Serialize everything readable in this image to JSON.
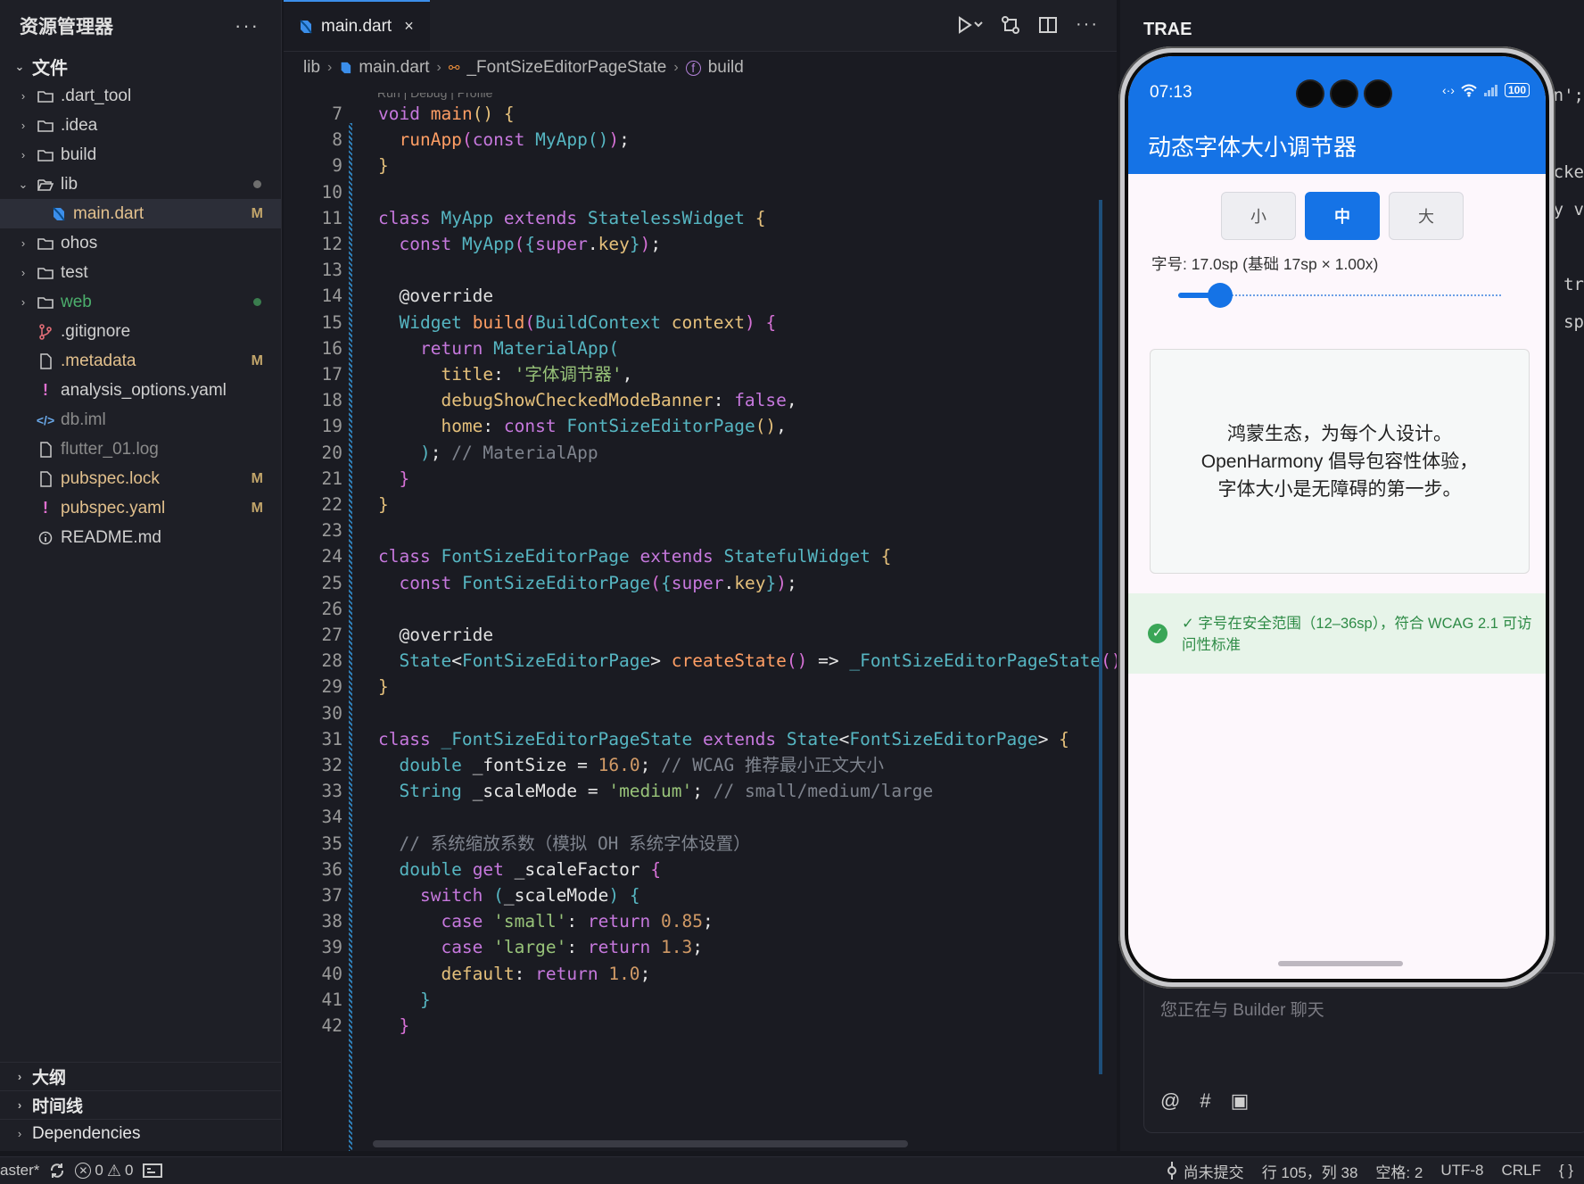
{
  "explorer": {
    "title": "资源管理器",
    "more": "···",
    "section_files": "文件",
    "items": [
      {
        "label": ".dart_tool",
        "type": "folder",
        "status": ""
      },
      {
        "label": ".idea",
        "type": "folder",
        "status": ""
      },
      {
        "label": "build",
        "type": "folder",
        "status": ""
      },
      {
        "label": "lib",
        "type": "folder-open",
        "status": ""
      },
      {
        "label": "main.dart",
        "type": "dart",
        "status": "M"
      },
      {
        "label": "ohos",
        "type": "folder",
        "status": ""
      },
      {
        "label": "test",
        "type": "folder",
        "status": ""
      },
      {
        "label": "web",
        "type": "folder",
        "status": ""
      },
      {
        "label": ".gitignore",
        "type": "git",
        "status": ""
      },
      {
        "label": ".metadata",
        "type": "file",
        "status": "M"
      },
      {
        "label": "analysis_options.yaml",
        "type": "yaml",
        "status": ""
      },
      {
        "label": "db.iml",
        "type": "code",
        "status": ""
      },
      {
        "label": "flutter_01.log",
        "type": "file",
        "status": ""
      },
      {
        "label": "pubspec.lock",
        "type": "file",
        "status": "M"
      },
      {
        "label": "pubspec.yaml",
        "type": "yaml",
        "status": "M"
      },
      {
        "label": "README.md",
        "type": "info",
        "status": ""
      }
    ],
    "bottom": [
      "大纲",
      "时间线",
      "Dependencies"
    ]
  },
  "editor": {
    "tab_label": "main.dart",
    "tab_close": "×",
    "breadcrumb": [
      "lib",
      "main.dart",
      "_FontSizeEditorPageState",
      "build"
    ],
    "codelens": "Run | Debug | Profile",
    "lines": [
      {
        "n": "7",
        "html": "<span class='kw'>void</span> <span class='fn'>main</span><span class='pn'>()</span> <span class='pn'>{</span>"
      },
      {
        "n": "8",
        "html": "  <span class='fn'>runApp</span><span class='pr'>(</span><span class='kw'>const</span> <span class='cls'>MyApp</span><span class='cls'>()</span><span class='pr'>)</span>;"
      },
      {
        "n": "9",
        "html": "<span class='pn'>}</span>"
      },
      {
        "n": "10",
        "html": ""
      },
      {
        "n": "11",
        "html": "<span class='kw'>class</span> <span class='cls'>MyApp</span> <span class='kw'>extends</span> <span class='cls'>StatelessWidget</span> <span class='pn'>{</span>"
      },
      {
        "n": "12",
        "html": "  <span class='kw'>const</span> <span class='cls'>MyApp</span><span class='pr'>(</span><span class='cls'>{</span><span class='kw'>super</span>.<span class='prop'>key</span><span class='cls'>}</span><span class='pr'>)</span>;"
      },
      {
        "n": "13",
        "html": ""
      },
      {
        "n": "14",
        "html": "  <span class='ann'>@override</span>"
      },
      {
        "n": "15",
        "html": "  <span class='cls'>Widget</span> <span class='fn'>build</span><span class='pr'>(</span><span class='cls'>BuildContext</span> <span class='prop'>context</span><span class='pr'>)</span> <span class='pr'>{</span>"
      },
      {
        "n": "16",
        "html": "    <span class='kw'>return</span> <span class='cls'>MaterialApp</span><span class='cls'>(</span>"
      },
      {
        "n": "17",
        "html": "      <span class='prop'>title</span>: <span class='str'>'字体调节器'</span>,"
      },
      {
        "n": "18",
        "html": "      <span class='prop'>debugShowCheckedModeBanner</span>: <span class='kw'>false</span>,"
      },
      {
        "n": "19",
        "html": "      <span class='prop'>home</span>: <span class='kw'>const</span> <span class='cls'>FontSizeEditorPage</span><span class='pn'>()</span>,"
      },
      {
        "n": "20",
        "html": "    <span class='cls'>)</span>; <span class='cm'>// MaterialApp</span>"
      },
      {
        "n": "21",
        "html": "  <span class='pr'>}</span>"
      },
      {
        "n": "22",
        "html": "<span class='pn'>}</span>"
      },
      {
        "n": "23",
        "html": ""
      },
      {
        "n": "24",
        "html": "<span class='kw'>class</span> <span class='cls'>FontSizeEditorPage</span> <span class='kw'>extends</span> <span class='cls'>StatefulWidget</span> <span class='pn'>{</span>"
      },
      {
        "n": "25",
        "html": "  <span class='kw'>const</span> <span class='cls'>FontSizeEditorPage</span><span class='pr'>(</span><span class='cls'>{</span><span class='kw'>super</span>.<span class='prop'>key</span><span class='cls'>}</span><span class='pr'>)</span>;"
      },
      {
        "n": "26",
        "html": ""
      },
      {
        "n": "27",
        "html": "  <span class='ann'>@override</span>"
      },
      {
        "n": "28",
        "html": "  <span class='cls'>State</span>&lt;<span class='cls'>FontSizeEditorPage</span>&gt; <span class='fn'>createState</span><span class='pr'>()</span> =&gt; <span class='cls'>_FontSizeEditorPageState</span><span class='pr'>()</span>"
      },
      {
        "n": "29",
        "html": "<span class='pn'>}</span>"
      },
      {
        "n": "30",
        "html": ""
      },
      {
        "n": "31",
        "html": "<span class='kw'>class</span> <span class='cls'>_FontSizeEditorPageState</span> <span class='kw'>extends</span> <span class='cls'>State</span>&lt;<span class='cls'>FontSizeEditorPage</span>&gt; <span class='pn'>{</span>"
      },
      {
        "n": "32",
        "html": "  <span class='cls'>double</span> <span class='id'>_fontSize</span> = <span class='num'>16.0</span>; <span class='cm'>// WCAG 推荐最小正文大小</span>"
      },
      {
        "n": "33",
        "html": "  <span class='cls'>String</span> <span class='id'>_scaleMode</span> = <span class='str'>'medium'</span>; <span class='cm'>// small/medium/large</span>"
      },
      {
        "n": "34",
        "html": ""
      },
      {
        "n": "35",
        "html": "  <span class='cm'>// 系统缩放系数（模拟 OH 系统字体设置）</span>"
      },
      {
        "n": "36",
        "html": "  <span class='cls'>double</span> <span class='kw'>get</span> <span class='id'>_scaleFactor</span> <span class='pr'>{</span>"
      },
      {
        "n": "37",
        "html": "    <span class='kw'>switch</span> <span class='cls'>(</span><span class='id'>_scaleMode</span><span class='cls'>)</span> <span class='cls'>{</span>"
      },
      {
        "n": "38",
        "html": "      <span class='kw'>case</span> <span class='str'>'small'</span>: <span class='kw'>return</span> <span class='num'>0.85</span>;"
      },
      {
        "n": "39",
        "html": "      <span class='kw'>case</span> <span class='str'>'large'</span>: <span class='kw'>return</span> <span class='num'>1.3</span>;"
      },
      {
        "n": "40",
        "html": "      <span class='prop'>default</span>: <span class='kw'>return</span> <span class='num'>1.0</span>;"
      },
      {
        "n": "41",
        "html": "    <span class='cls'>}</span>"
      },
      {
        "n": "42",
        "html": "  <span class='pr'>}</span>"
      }
    ]
  },
  "right": {
    "title": "TRAE",
    "chat_placeholder": "您正在与 Builder 聊天",
    "chat_icons": [
      "@",
      "#",
      "▣"
    ],
    "peek": [
      "n';",
      "cke",
      "y v",
      "tr",
      "sp"
    ]
  },
  "phone": {
    "time": "07:13",
    "battery": "100",
    "app_title": "动态字体大小调节器",
    "segments": [
      {
        "label": "小",
        "selected": false
      },
      {
        "label": "中",
        "selected": true
      },
      {
        "label": "大",
        "selected": false
      }
    ],
    "font_label": "字号: 17.0sp (基础 17sp × 1.00x)",
    "slider_fraction": 0.13,
    "preview_lines": [
      "鸿蒙生态，为每个人设计。",
      "OpenHarmony 倡导包容性体验，",
      "字体大小是无障碍的第一步。"
    ],
    "banner_text": "✓ 字号在安全范围（12–36sp），符合 WCAG 2.1 可访问性标准"
  },
  "statusbar": {
    "branch": "aster*",
    "errors": "0",
    "warnings": "0",
    "commit": "尚未提交",
    "position": "行 105，列 38",
    "spaces": "空格: 2",
    "encoding": "UTF-8",
    "eol": "CRLF",
    "braces": "{ }"
  }
}
